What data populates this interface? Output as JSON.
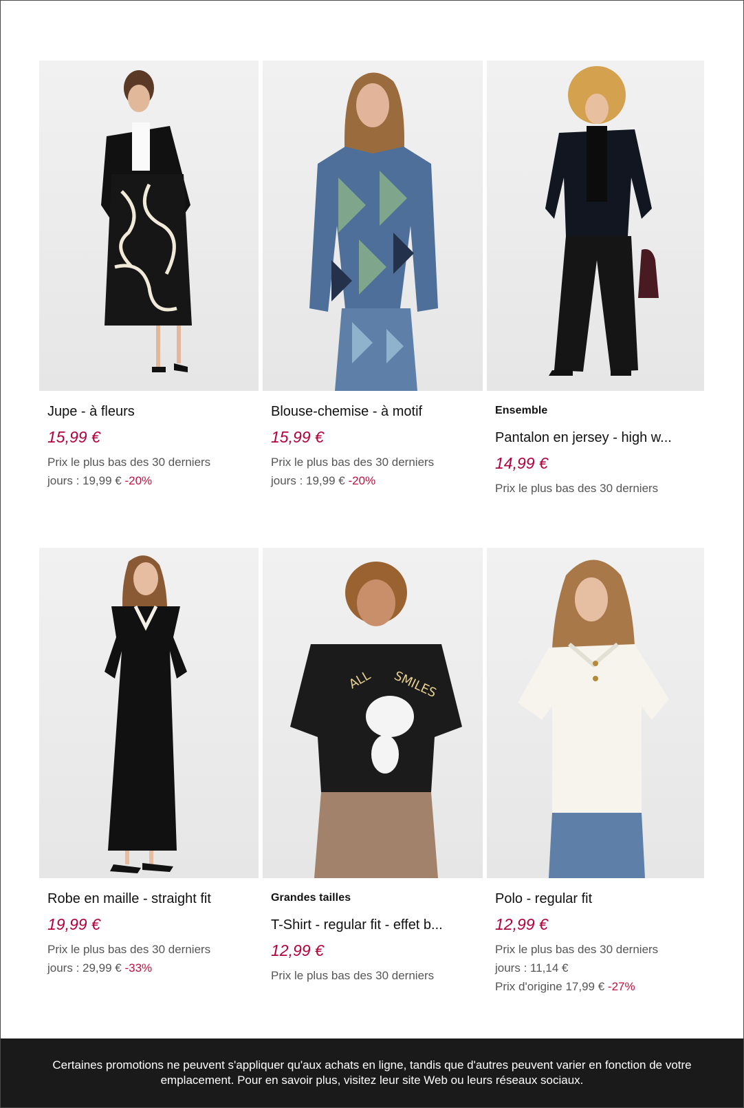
{
  "products": [
    {
      "tag": "",
      "name": "Jupe - à fleurs",
      "price": "15,99 €",
      "note_line1": "Prix le plus bas des 30 derniers",
      "note_line2": "jours : 19,99 €",
      "discount": "-20%"
    },
    {
      "tag": "",
      "name": "Blouse-chemise - à motif",
      "price": "15,99 €",
      "note_line1": "Prix le plus bas des 30 derniers",
      "note_line2": "jours : 19,99 €",
      "discount": "-20%"
    },
    {
      "tag": "Ensemble",
      "name": "Pantalon en jersey - high w...",
      "price": "14,99 €",
      "note_line1": "Prix le plus bas des 30 derniers"
    },
    {
      "tag": "",
      "name": "Robe en maille - straight fit",
      "price": "19,99 €",
      "note_line1": "Prix le plus bas des 30 derniers",
      "note_line2": "jours : 29,99 €",
      "discount": "-33%"
    },
    {
      "tag": "Grandes tailles",
      "name": "T-Shirt - regular fit - effet b...",
      "price": "12,99 €",
      "note_line1": "Prix le plus bas des 30 derniers"
    },
    {
      "tag": "",
      "name": "Polo - regular fit",
      "price": "12,99 €",
      "note_line1": "Prix le plus bas des 30 derniers",
      "note_line2": "jours : 11,14 €",
      "note_line3": "Prix d'origine 17,99 €",
      "discount": "-27%"
    }
  ],
  "footer_text": "Certaines promotions ne peuvent s'appliquer qu'aux achats en ligne, tandis que d'autres peuvent varier en fonction de votre emplacement. Pour en savoir plus, visitez leur site Web ou leurs réseaux sociaux."
}
